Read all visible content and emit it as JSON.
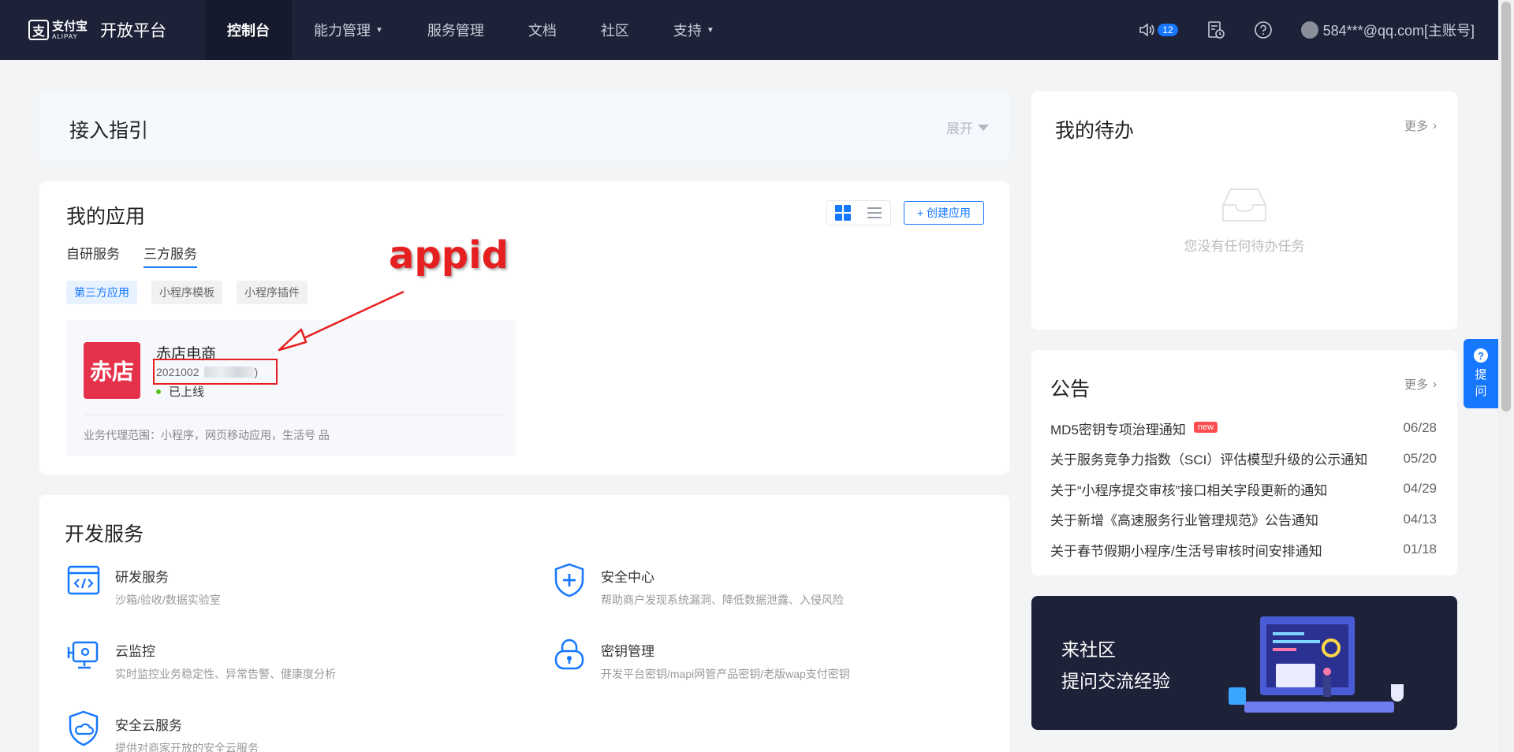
{
  "header": {
    "logo_cn": "支付宝",
    "logo_en": "ALIPAY",
    "platform": "开放平台",
    "nav": [
      {
        "label": "控制台"
      },
      {
        "label": "能力管理"
      },
      {
        "label": "服务管理"
      },
      {
        "label": "文档"
      },
      {
        "label": "社区"
      },
      {
        "label": "支持"
      }
    ],
    "notification_count": "12",
    "account": "584***@qq.com[主账号]"
  },
  "guide": {
    "title": "接入指引",
    "expand": "展开"
  },
  "my_apps": {
    "title": "我的应用",
    "create_label": "+ 创建应用",
    "tabs": [
      {
        "label": "自研服务"
      },
      {
        "label": "三方服务"
      }
    ],
    "chips": [
      {
        "label": "第三方应用"
      },
      {
        "label": "小程序模板"
      },
      {
        "label": "小程序插件"
      }
    ],
    "app": {
      "logo_text": "赤店",
      "name": "赤店电商",
      "id_prefix": "2021002",
      "id_suffix": ")",
      "status": "已上线",
      "scope": "业务代理范围：小程序，网页移动应用，生活号 品"
    },
    "annotation": "appid"
  },
  "dev_services": {
    "title": "开发服务",
    "items": [
      {
        "name": "研发服务",
        "desc": "沙箱/验收/数据实验室",
        "icon": "code-window-icon"
      },
      {
        "name": "安全中心",
        "desc": "帮助商户发现系统漏洞、降低数据泄露、入侵风险",
        "icon": "shield-plus-icon"
      },
      {
        "name": "云监控",
        "desc": "实时监控业务稳定性、异常告警、健康度分析",
        "icon": "monitor-icon"
      },
      {
        "name": "密钥管理",
        "desc": "开发平台密钥/mapi网管产品密钥/老版wap支付密钥",
        "icon": "lock-icon"
      },
      {
        "name": "安全云服务",
        "desc": "提供对商家开放的安全云服务",
        "icon": "shield-cloud-icon"
      }
    ]
  },
  "todo": {
    "title": "我的待办",
    "more": "更多",
    "empty": "您没有任何待办任务"
  },
  "notice": {
    "title": "公告",
    "more": "更多",
    "new_tag": "new",
    "items": [
      {
        "title": "MD5密钥专项治理通知",
        "date": "06/28"
      },
      {
        "title": "关于服务竞争力指数（SCI）评估模型升级的公示通知",
        "date": "05/20"
      },
      {
        "title": "关于“小程序提交审核”接口相关字段更新的通知",
        "date": "04/29"
      },
      {
        "title": "关于新增《高速服务行业管理规范》公告通知",
        "date": "04/13"
      },
      {
        "title": "关于春节假期小程序/生活号审核时间安排通知",
        "date": "01/18"
      }
    ]
  },
  "community": {
    "line1": "来社区",
    "line2": "提问交流经验"
  },
  "ask": {
    "label1": "提",
    "label2": "问"
  },
  "colors": {
    "nav_bg": "#1d2238",
    "accent": "#1677ff",
    "annotation": "#e62020",
    "app_logo": "#e5314a"
  }
}
